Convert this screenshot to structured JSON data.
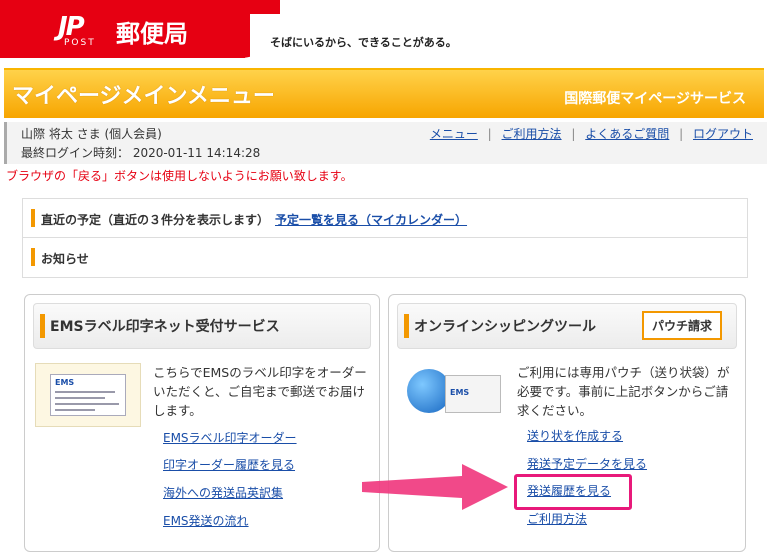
{
  "header": {
    "logo_mark": "JP",
    "logo_post": "POST",
    "logo_name": "郵便局",
    "tagline": "そばにいるから、できることがある。"
  },
  "banner": {
    "title": "マイページメインメニュー",
    "service": "国際郵便マイページサービス"
  },
  "user": {
    "name_line": "山際 将太 さま (個人会員)",
    "last_login": "最終ログイン時刻： 2020-01-11 14:14:28",
    "links": [
      "メニュー",
      "ご利用方法",
      "よくあるご質問",
      "ログアウト"
    ]
  },
  "warning": "ブラウザの「戻る」ボタンは使用しないようにお願い致します。",
  "notice": {
    "schedule_label": "直近の予定（直近の３件分を表示します）",
    "schedule_link": "予定一覧を見る（マイカレンダー）",
    "news_label": "お知らせ"
  },
  "ems_card": {
    "title": "EMSラベル印字ネット受付サービス",
    "description": "こちらでEMSのラベル印字をオーダーいただくと、ご自宅まで郵送でお届けします。",
    "image_text": "EMS",
    "links": [
      "EMSラベル印字オーダー",
      "印字オーダー履歴を見る",
      "海外への発送品英訳集",
      "EMS発送の流れ"
    ]
  },
  "shipping_card": {
    "title": "オンラインシッピングツール",
    "pouch_button": "パウチ請求",
    "description": "ご利用には専用パウチ（送り状袋）が必要です。事前に上記ボタンからご請求ください。",
    "image_text": "EMS",
    "links": [
      "送り状を作成する",
      "発送予定データを見る",
      "発送履歴を見る",
      "ご利用方法"
    ]
  },
  "colors": {
    "brand_red": "#e60012",
    "banner_orange": "#f7a500",
    "accent_orange": "#f39800",
    "link_blue": "#1a4ea8",
    "highlight_pink": "#e8197a"
  }
}
